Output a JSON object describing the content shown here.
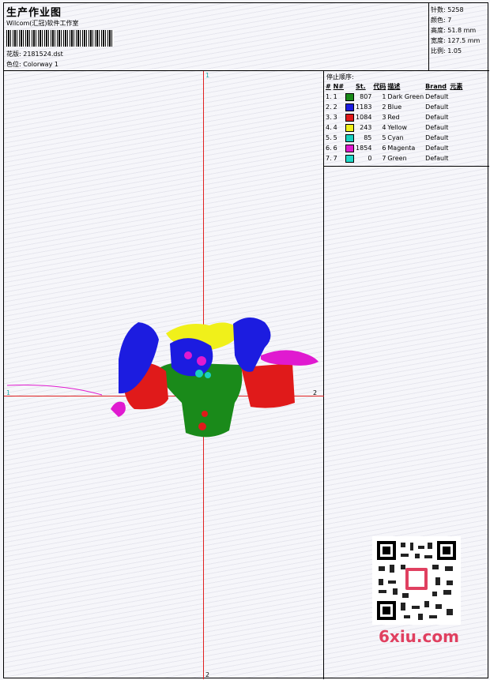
{
  "header": {
    "title": "生产作业图",
    "subtitle": "Wilcom(汇冠)软件工作室",
    "pattern_label": "花版:",
    "pattern_value": "2181524.dst",
    "colorway_label": "色位:",
    "colorway_value": "Colorway 1"
  },
  "stats": {
    "stitches_label": "针数:",
    "stitches": "5258",
    "colors_label": "颜色:",
    "colors": "7",
    "height_label": "高度:",
    "height": "51.8 mm",
    "width_label": "宽度:",
    "width": "127.5 mm",
    "scale_label": "比例:",
    "scale": "1.05"
  },
  "canvas": {
    "axis_top": "1",
    "axis_bottom": "2",
    "axis_left": "1",
    "axis_right": "2"
  },
  "stop_sequence": {
    "title": "停止顺序:",
    "headers": [
      "#",
      "N#",
      "St.",
      "代码",
      "描述",
      "Brand",
      "元素"
    ],
    "rows": [
      {
        "idx": "1.",
        "n": "1",
        "color": "#1a8a1a",
        "st": "807",
        "code": "1",
        "desc": "Dark Green",
        "brand": "Default"
      },
      {
        "idx": "2.",
        "n": "2",
        "color": "#1c1ce0",
        "st": "1183",
        "code": "2",
        "desc": "Blue",
        "brand": "Default"
      },
      {
        "idx": "3.",
        "n": "3",
        "color": "#e01a1a",
        "st": "1084",
        "code": "3",
        "desc": "Red",
        "brand": "Default"
      },
      {
        "idx": "4.",
        "n": "4",
        "color": "#f0f01a",
        "st": "243",
        "code": "4",
        "desc": "Yellow",
        "brand": "Default"
      },
      {
        "idx": "5.",
        "n": "5",
        "color": "#1ad0c0",
        "st": "85",
        "code": "5",
        "desc": "Cyan",
        "brand": "Default"
      },
      {
        "idx": "6.",
        "n": "6",
        "color": "#e01ad0",
        "st": "1854",
        "code": "6",
        "desc": "Magenta",
        "brand": "Default"
      },
      {
        "idx": "7.",
        "n": "7",
        "color": "#20d8c8",
        "st": "0",
        "code": "7",
        "desc": "Green",
        "brand": "Default"
      }
    ]
  },
  "watermark": {
    "site": "6xiu.com"
  }
}
